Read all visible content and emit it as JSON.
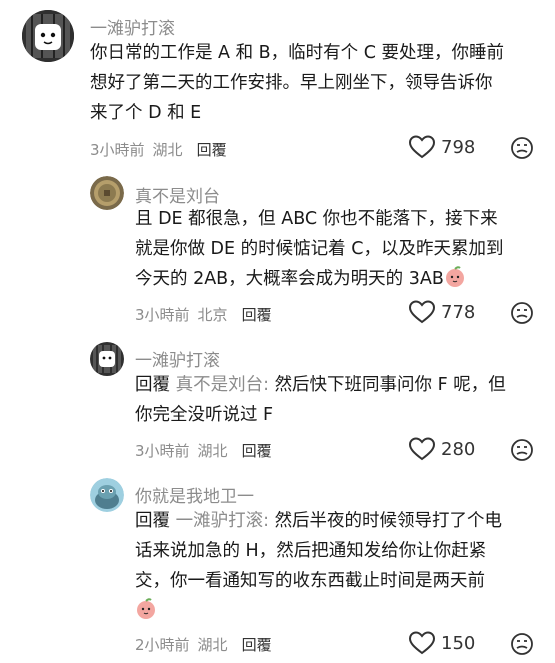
{
  "comments": [
    {
      "username": "一滩驴打滚",
      "text_lines": [
        "你日常的工作是 A 和 B，临时有个 C 要处理，你睡前",
        "想好了第二天的工作安排。早上刚坐下，领导告诉你",
        "来了个 D 和 E"
      ],
      "time": "3小時前",
      "location": "湖北",
      "reply_label": "回覆",
      "likes": "798"
    },
    {
      "username": "真不是刘台",
      "text_lines": [
        "且 DE 都很急，但 ABC 你也不能落下，接下来",
        "就是你做 DE 的时候惦记着 C，以及昨天累加到",
        "今天的 2AB，大概率会成为明天的 3AB"
      ],
      "time": "3小時前",
      "location": "北京",
      "reply_label": "回覆",
      "likes": "778"
    },
    {
      "username": "一滩驴打滚",
      "reply_prefix": "回覆",
      "reply_target": "真不是刘台:",
      "text_lines": [
        "然后快下班同事问你 F 呢，但",
        "你完全没听说过 F"
      ],
      "time": "3小時前",
      "location": "湖北",
      "reply_label": "回覆",
      "likes": "280"
    },
    {
      "username": "你就是我地卫一",
      "reply_prefix": "回覆",
      "reply_target": "一滩驴打滚:",
      "text_lines": [
        "然后半夜的时候领导打了个电",
        "话来说加急的 H，然后把通知发给你让你赶紧",
        "交，你一看通知写的收东西截止时间是两天前"
      ],
      "time": "2小時前",
      "location": "湖北",
      "reply_label": "回覆",
      "likes": "150"
    }
  ],
  "icons": {
    "like": "heart-outline-icon",
    "dislike": "dislike-face-icon",
    "emoji": "peach-face-emoji"
  },
  "colors": {
    "text": "#1a1a1a",
    "secondary": "#8c8c8c",
    "emoji_pink": "#f3a6a0"
  }
}
